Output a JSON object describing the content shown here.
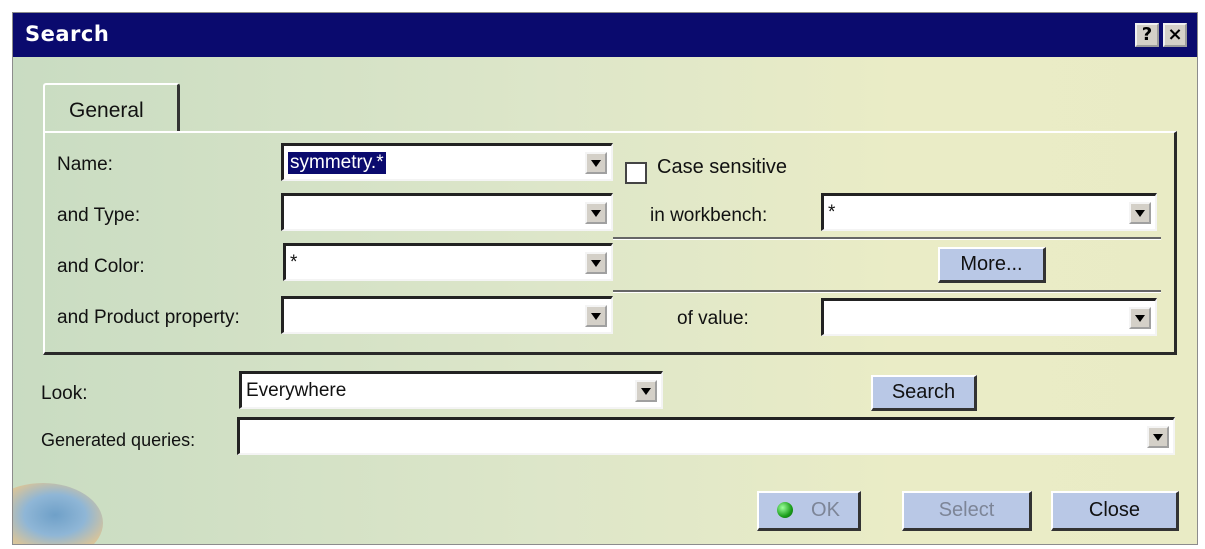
{
  "window": {
    "title": "Search",
    "help_label": "?",
    "close_label": "×"
  },
  "tab": {
    "label": "General"
  },
  "general": {
    "name_label": "Name:",
    "name_value": "symmetry.*",
    "case_sensitive_label": "Case sensitive",
    "type_label": "and Type:",
    "type_value": "",
    "workbench_label": "in workbench:",
    "workbench_value": "*",
    "color_label": "and Color:",
    "color_value": "*",
    "more_label": "More...",
    "product_property_label": "and Product property:",
    "product_property_value": "",
    "of_value_label": "of value:",
    "of_value_value": ""
  },
  "look": {
    "label": "Look:",
    "value": "Everywhere"
  },
  "search_label": "Search",
  "generated_queries": {
    "label": "Generated queries:",
    "value": ""
  },
  "footer": {
    "ok_label": "OK",
    "select_label": "Select",
    "close_label": "Close"
  },
  "icons": {
    "help": "help-icon",
    "close": "close-icon",
    "dropdown": "chevron-down-icon",
    "ok_indicator": "green-dot-icon"
  },
  "colors": {
    "titlebar": "#0a0a6e",
    "button_face": "#b9c8e6",
    "selection": "#0a0a6e"
  }
}
